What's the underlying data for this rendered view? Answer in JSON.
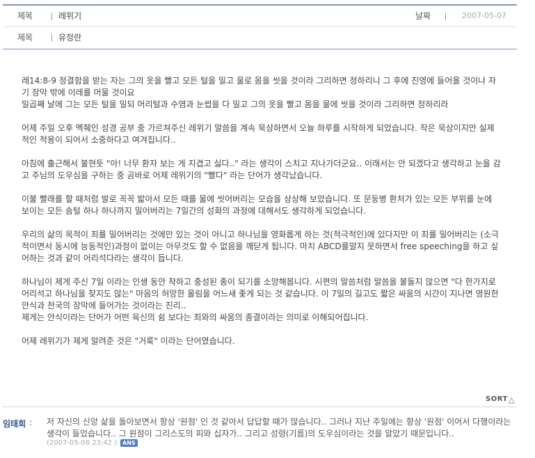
{
  "post": {
    "title_label": "제목",
    "title_value": "레위기",
    "date_label": "날짜",
    "date_value": "2007-05-07",
    "subject_label": "제목",
    "subject_value": "유정란"
  },
  "body_paragraphs": [
    "레14:8-9 정결함을 받는 자는 그의 옷을 빨고 모든 털을 밀고 물로 몸을 씻을 것이라 그리하면 정하리니 그 후에 진영에 들어올 것이나 자기 장막 밖에 이레를 머물 것이요\n일곱째 날에 그는 모든 털을 밀되 머리털과 수염과 눈썹을 다 밀고 그의 옷을 빨고 몸을 물에 씻을 것이라 그리하면 정하리라",
    "",
    "어제 주일 오후 멕췌인 성경 공부 중 가르쳐주신 레위기 말씀을 계속 묵상하면서 오늘 하루를 시작하게 되었습니다. 작은 묵상이지만 실제적인 적용이 되어서 소중하다고 여겨집니다..",
    "아침에 출근해서 불현듯 \"아! 너무 환자 보는 게 지겹고 싫다..\" 라는 생각이 스치고 지나가더군요.. 이래서는 안 되겠다고 생각하고 눈을 감고 주님의 도우심을 구하는 중 곰바로 어제 레위기의 \"빨다\" 라는 단어가 생각났습니다.",
    "이불 빨래를 할 때처럼 발로 꼭꼭 밟아서 모든 때를 물에 씻어버리는 모습을 상상해 보았습니다. 또 문둥병 환처가 있는 모든 부위를 눈에 보이는 모든 솜털 하나 하나까지 밀어버리는 7일간의 성화의 과정에 대해서도 생각하게 되었습니다.",
    "우리의 삶의 목적이 죄를 밀어버리는 것에만 있는 것이 아니고 하나님을 영화롭게 하는 것(적극적인)에 있다지만 이 죄를 밀어버리는 (소극적이면서 동시에 능동적인)과정이 없이는 아무것도 할 수 없음을 깨닫게 됩니다. 마치 ABCD를알지 못하면서 free speeching을 하고 싶어하는 것과 같이 어리석다라는 생각이 듭니다.",
    "하나님이 제게 주신 7일 이라는 인생 동안 착하고 충성된 종이 되기를 소망해봅니다. 시편의 말씀처럼 말씀을 불들지 않으면 \"다 한가지로 어리석고 하나님을 찾지도 않는\" 마음의 허망한 울림을 어느새 좇게 되는 것 같습니다. 이 7일의 길고도 짧은 싸움의 시간이 지나면 영원한 안식과 천국의 장막에 들어가는 것이라는 진리..\n제게는 안식이라는 단어가 어떤 육신의 쉼 보다는 죄와의 싸움의 종결이라는 의미로 이해되어집니다.",
    "어제 레위기가 제게 알려준 것은 \"거룩\" 이라는 단어였습니다."
  ],
  "sort": {
    "label": "SORT",
    "icon": "triangle-up-icon"
  },
  "comment": {
    "author": "임태희",
    "colon": ":",
    "text": "저 자신의 신앙 삶을 돌아보면서 항상 '원점' 인 것 같아서 답답할 때가 많습니다.. 그러나 지난 주일에는 항상 '원점' 이어서 다행이라는 생각이 들었습니다.. 그 원점이 그리스도의 피와 십자가.. 그리고 성령(기름)의 도우심이라는 것을 알았기 때문입니다..",
    "timestamp": "(2007-05-08 23:42 )",
    "badge": "ANS"
  },
  "colors": {
    "rule": "#7f93b8",
    "author": "#2f4f8f",
    "badge": "#4f7fc2"
  }
}
